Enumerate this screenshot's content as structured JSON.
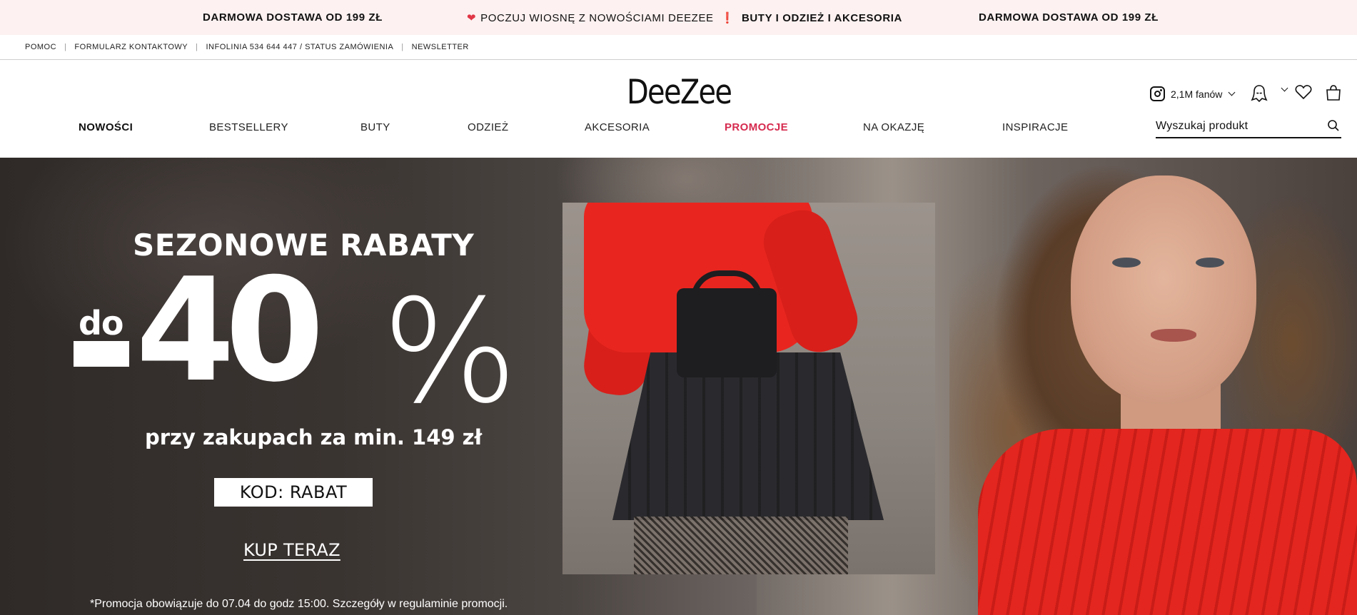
{
  "promo_strip": {
    "left": "DARMOWA DOSTAWA OD 199 ZŁ",
    "middle_prefix": "POCZUJ WIOSNĘ Z NOWOŚCIAMI DEEZEE",
    "middle_suffix": "BUTY I ODZIEŻ I AKCESORIA",
    "right": "DARMOWA DOSTAWA OD 199 ZŁ",
    "accent_color": "#e03545"
  },
  "utility_links": [
    "POMOC",
    "FORMULARZ KONTAKTOWY",
    "INFOLINIA 534 644 447 / STATUS ZAMÓWIENIA",
    "NEWSLETTER"
  ],
  "header": {
    "logo": "DeeZee",
    "social_fans": "2,1M fanów",
    "search_placeholder": "Wyszukaj produkt"
  },
  "nav": [
    "NOWOŚCI",
    "BESTSELLERY",
    "BUTY",
    "ODZIEŻ",
    "AKCESORIA",
    "PROMOCJE",
    "NA OKAZJĘ",
    "INSPIRACJE"
  ],
  "nav_promo_color": "#d62b4f",
  "hero": {
    "headline": "SEZONOWE RABATY",
    "prefix": "do",
    "discount": "40",
    "percent_sign": "%",
    "subheadline": "przy zakupach za min. 149 zł",
    "code": "KOD: RABAT",
    "cta": "KUP TERAZ",
    "disclaimer": "*Promocja obowiązuje do 07.04 do godz 15:00. Szczegóły w regulaminie promocji."
  }
}
